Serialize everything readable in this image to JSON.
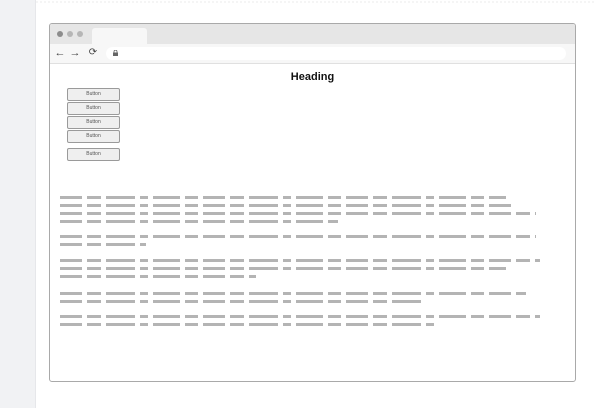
{
  "page": {
    "heading": "Heading"
  },
  "buttons": [
    {
      "label": "Button"
    },
    {
      "label": "Button"
    },
    {
      "label": "Button"
    },
    {
      "label": "Button"
    },
    {
      "label": "Button"
    }
  ],
  "icons": {
    "back": "arrow-left",
    "forward": "arrow-right",
    "reload": "reload",
    "lock": "lock"
  },
  "colors": {
    "placeholder_text": "#b4b4b4",
    "window_border": "#a9a9a9",
    "titlebar": "#e6e6e6"
  }
}
